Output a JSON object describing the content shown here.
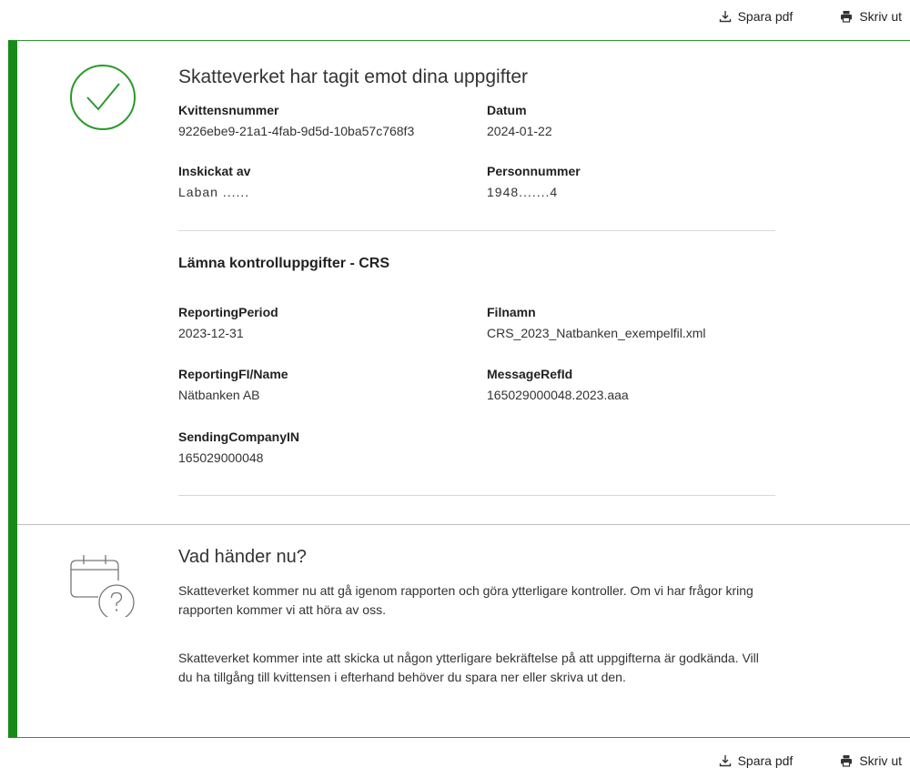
{
  "toolbar": {
    "save_pdf": "Spara pdf",
    "print": "Skriv ut"
  },
  "receipt": {
    "title": "Skatteverket har tagit emot dina uppgifter",
    "fields": {
      "receipt_number_label": "Kvittensnummer",
      "receipt_number": "9226ebe9-21a1-4fab-9d5d-10ba57c768f3",
      "date_label": "Datum",
      "date": "2024-01-22",
      "sent_by_label": "Inskickat av",
      "sent_by": "Laban ......",
      "personal_number_label": "Personnummer",
      "personal_number": "1948.......4"
    },
    "subheading": "Lämna kontrolluppgifter - CRS",
    "details": {
      "reporting_period_label": "ReportingPeriod",
      "reporting_period": "2023-12-31",
      "filename_label": "Filnamn",
      "filename": "CRS_2023_Natbanken_exempelfil.xml",
      "reporting_fi_label": "ReportingFI/Name",
      "reporting_fi": "Nätbanken AB",
      "message_ref_label": "MessageRefId",
      "message_ref": "165029000048.2023.aaa",
      "sending_company_label": "SendingCompanyIN",
      "sending_company": "165029000048"
    }
  },
  "next_steps": {
    "title": "Vad händer nu?",
    "paragraph1": "Skatteverket kommer nu att gå igenom rapporten och göra ytterligare kontroller. Om vi har frågor kring rapporten kommer vi att höra av oss.",
    "paragraph2": "Skatteverket kommer inte att skicka ut någon ytterligare bekräftelse på att uppgifterna är godkända. Vill du ha tillgång till kvittensen i efterhand behöver du spara ner eller skriva ut den."
  },
  "colors": {
    "accent": "#188a18",
    "border": "#2b9a2b"
  }
}
